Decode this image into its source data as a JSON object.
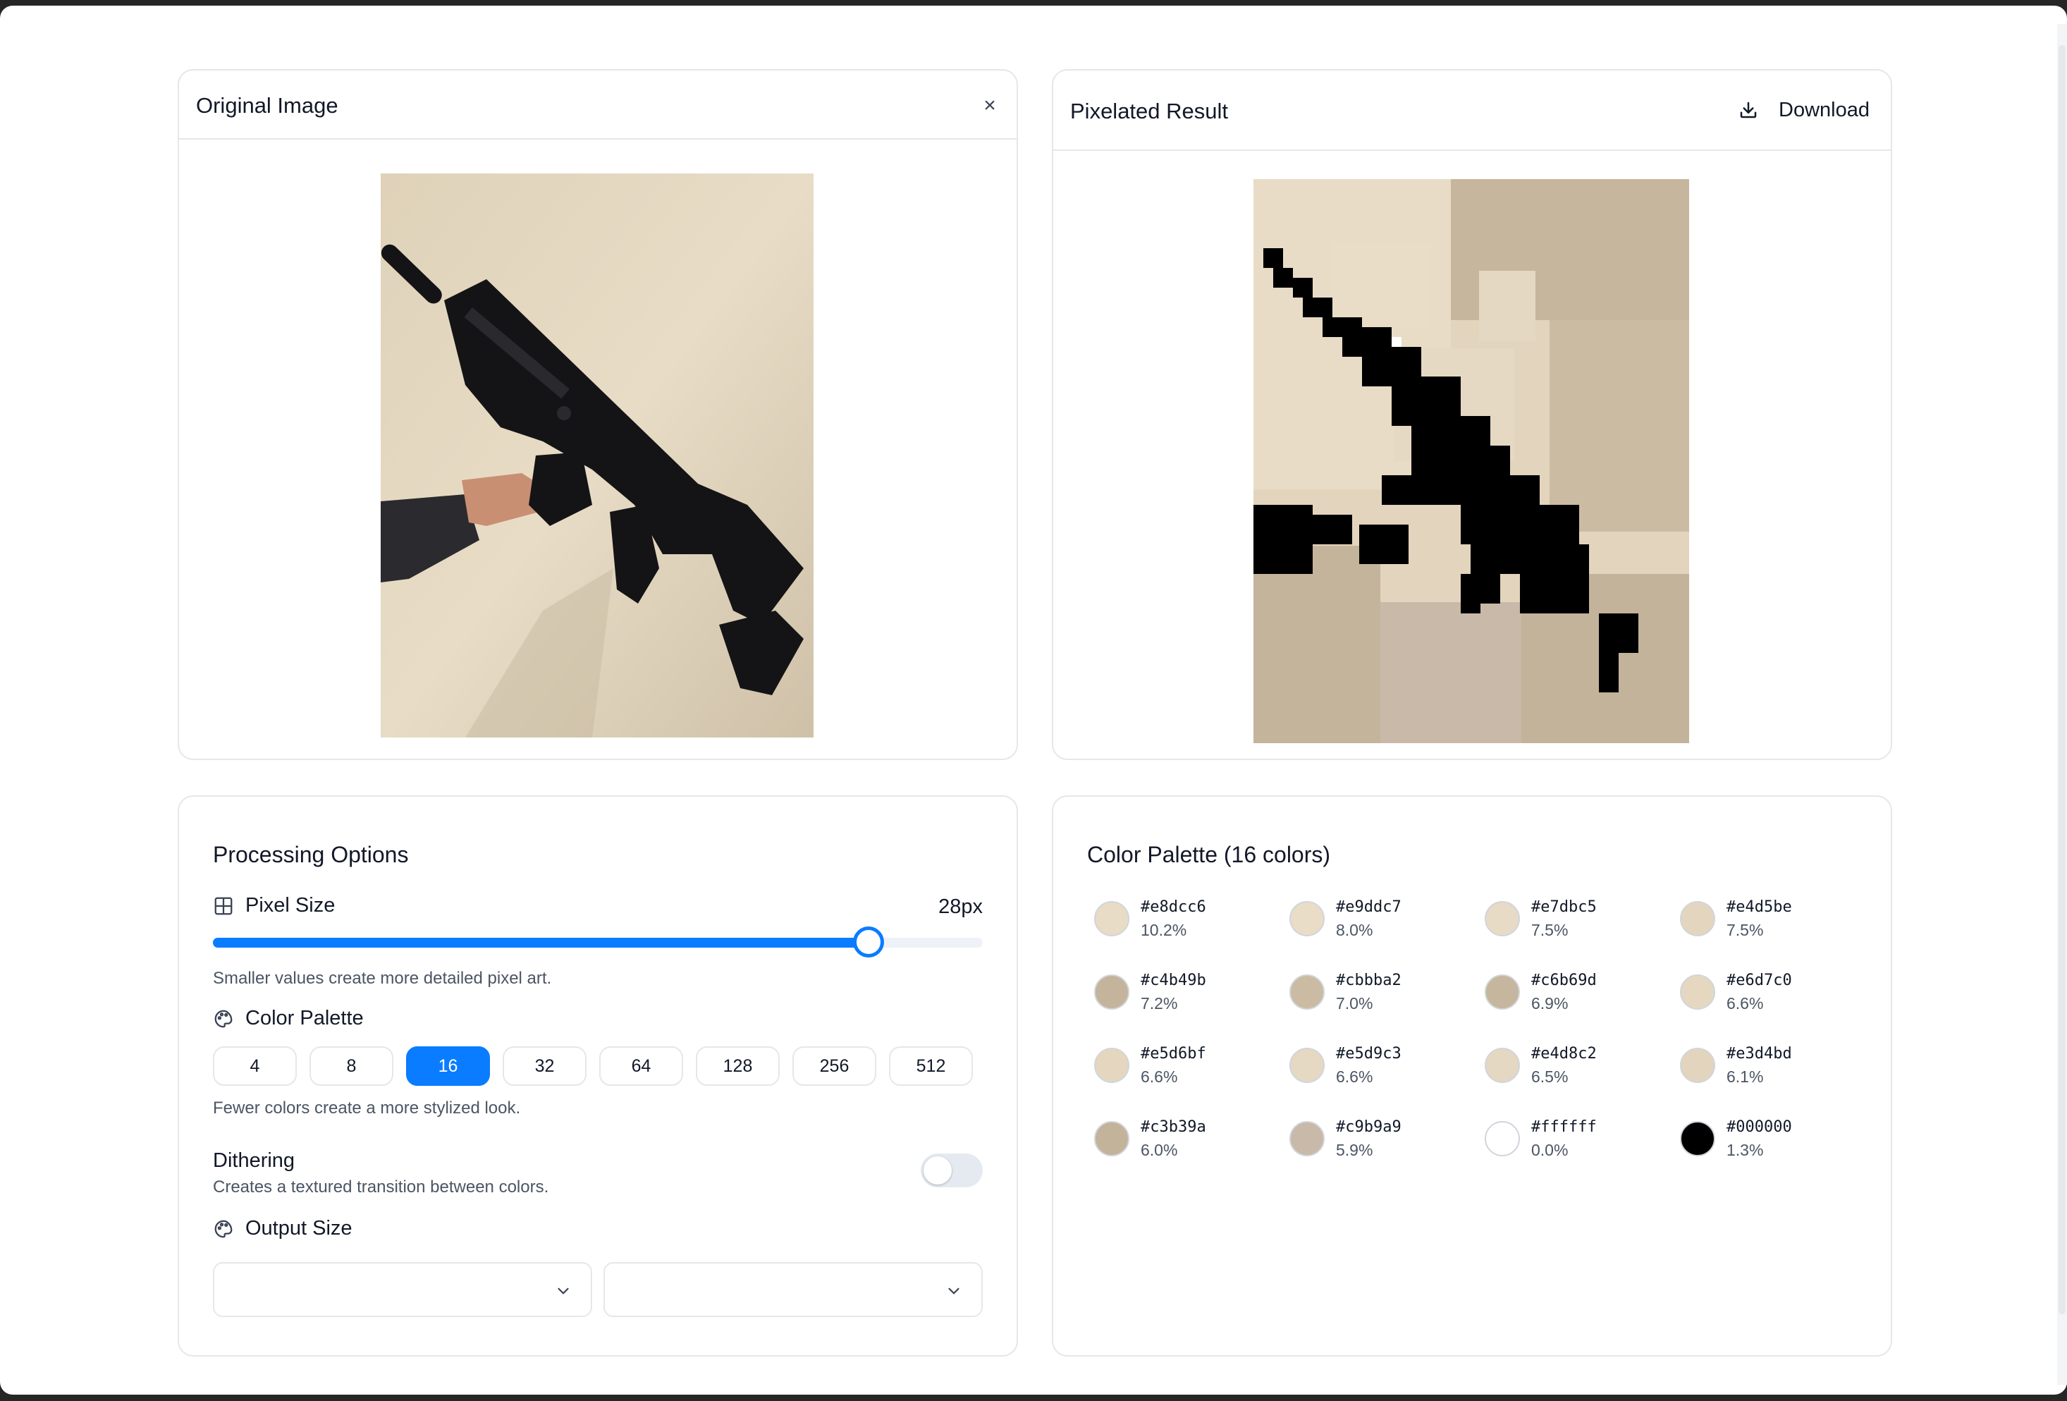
{
  "original": {
    "title": "Original Image",
    "close_label": "×"
  },
  "result": {
    "title": "Pixelated Result",
    "download_label": "Download"
  },
  "options": {
    "title": "Processing Options",
    "pixel_size": {
      "label": "Pixel Size",
      "value_text": "28px",
      "slider_fraction": 0.852,
      "hint": "Smaller values create more detailed pixel art."
    },
    "color_palette": {
      "label": "Color Palette",
      "choices": [
        "4",
        "8",
        "16",
        "32",
        "64",
        "128",
        "256",
        "512"
      ],
      "selected": "16",
      "hint": "Fewer colors create a more stylized look."
    },
    "dithering": {
      "label": "Dithering",
      "hint": "Creates a textured transition between colors.",
      "enabled": false
    },
    "output_size": {
      "label": "Output Size",
      "width_value": "",
      "height_value": ""
    }
  },
  "palette": {
    "title": "Color Palette (16 colors)",
    "colors": [
      {
        "hex": "#e8dcc6",
        "pct": "10.2%"
      },
      {
        "hex": "#e9ddc7",
        "pct": "8.0%"
      },
      {
        "hex": "#e7dbc5",
        "pct": "7.5%"
      },
      {
        "hex": "#e4d5be",
        "pct": "7.5%"
      },
      {
        "hex": "#c4b49b",
        "pct": "7.2%"
      },
      {
        "hex": "#cbbba2",
        "pct": "7.0%"
      },
      {
        "hex": "#c6b69d",
        "pct": "6.9%"
      },
      {
        "hex": "#e6d7c0",
        "pct": "6.6%"
      },
      {
        "hex": "#e5d6bf",
        "pct": "6.6%"
      },
      {
        "hex": "#e5d9c3",
        "pct": "6.6%"
      },
      {
        "hex": "#e4d8c2",
        "pct": "6.5%"
      },
      {
        "hex": "#e3d4bd",
        "pct": "6.1%"
      },
      {
        "hex": "#c3b39a",
        "pct": "6.0%"
      },
      {
        "hex": "#c9b9a9",
        "pct": "5.9%"
      },
      {
        "hex": "#ffffff",
        "pct": "0.0%"
      },
      {
        "hex": "#000000",
        "pct": "1.3%"
      }
    ]
  },
  "colors": {
    "accent": "#0a7cff",
    "border": "#e5e7eb",
    "muted_text": "#4b5563"
  }
}
